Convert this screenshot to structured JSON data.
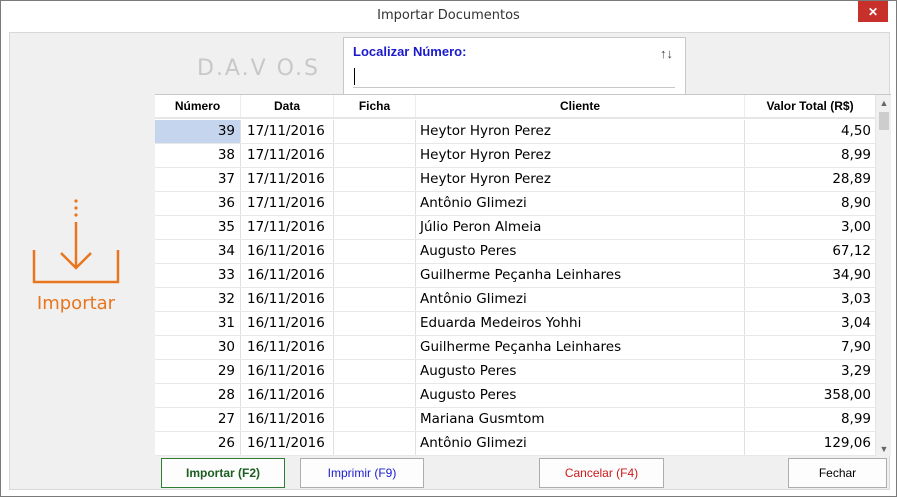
{
  "window": {
    "title": "Importar Documentos",
    "close_glyph": "✕"
  },
  "brand": {
    "text": "D.A.V O.S"
  },
  "sidebar": {
    "action_label": "Importar",
    "icon": "download-tray-icon",
    "accent_color": "#e8761e"
  },
  "search": {
    "label": "Localizar Número:",
    "value": "",
    "sort_glyph": "↑↓"
  },
  "table": {
    "headers": {
      "numero": "Número",
      "data": "Data",
      "ficha": "Ficha",
      "cliente": "Cliente",
      "total": "Valor Total (R$)"
    },
    "rows": [
      {
        "numero": "39",
        "data": "17/11/2016",
        "ficha": "",
        "cliente": "Heytor Hyron Perez",
        "total": "4,50"
      },
      {
        "numero": "38",
        "data": "17/11/2016",
        "ficha": "",
        "cliente": "Heytor Hyron Perez",
        "total": "8,99"
      },
      {
        "numero": "37",
        "data": "17/11/2016",
        "ficha": "",
        "cliente": "Heytor Hyron Perez",
        "total": "28,89"
      },
      {
        "numero": "36",
        "data": "17/11/2016",
        "ficha": "",
        "cliente": "Antônio GIimezi",
        "total": "8,90"
      },
      {
        "numero": "35",
        "data": "17/11/2016",
        "ficha": "",
        "cliente": "Júlio Peron Almeia",
        "total": "3,00"
      },
      {
        "numero": "34",
        "data": "16/11/2016",
        "ficha": "",
        "cliente": "Augusto Peres",
        "total": "67,12"
      },
      {
        "numero": "33",
        "data": "16/11/2016",
        "ficha": "",
        "cliente": "Guilherme Peçanha Leinhares",
        "total": "34,90"
      },
      {
        "numero": "32",
        "data": "16/11/2016",
        "ficha": "",
        "cliente": "Antônio GIimezi",
        "total": "3,03"
      },
      {
        "numero": "31",
        "data": "16/11/2016",
        "ficha": "",
        "cliente": "Eduarda Medeiros Yohhi",
        "total": "3,04"
      },
      {
        "numero": "30",
        "data": "16/11/2016",
        "ficha": "",
        "cliente": "Guilherme Peçanha Leinhares",
        "total": "7,90"
      },
      {
        "numero": "29",
        "data": "16/11/2016",
        "ficha": "",
        "cliente": "Augusto Peres",
        "total": "3,29"
      },
      {
        "numero": "28",
        "data": "16/11/2016",
        "ficha": "",
        "cliente": "Augusto Peres",
        "total": "358,00"
      },
      {
        "numero": "27",
        "data": "16/11/2016",
        "ficha": "",
        "cliente": "Mariana Gusmtom",
        "total": "8,99"
      },
      {
        "numero": "26",
        "data": "16/11/2016",
        "ficha": "",
        "cliente": "Antônio GIimezi",
        "total": "129,06"
      }
    ],
    "selected_index": 0,
    "selection_color": "#c5d5ee"
  },
  "scrollbar": {
    "up_glyph": "▲",
    "down_glyph": "▼"
  },
  "buttons": {
    "import": "Importar (F2)",
    "print": "Imprimir (F9)",
    "cancel": "Cancelar (F4)",
    "close": "Fechar"
  },
  "colors": {
    "import_green": "#1b5e20",
    "print_blue": "#1a1acc",
    "cancel_red": "#cc1a1a",
    "close_red": "#c7302b"
  }
}
